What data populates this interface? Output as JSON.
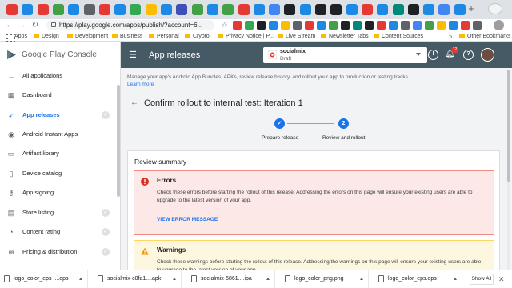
{
  "browser": {
    "url": "https://play.google.com/apps/publish/?account=6...",
    "new_tab_symbol": "+",
    "tab_colors": [
      "#e53935",
      "#1e88e5",
      "#e53935",
      "#43a047",
      "#1e88e5",
      "#5f6368",
      "#e53935",
      "#1e88e5",
      "#34a853",
      "#fbbc04",
      "#1e88e5",
      "#3f51b5",
      "#43a047",
      "#1e88e5",
      "#43a047",
      "#e53935",
      "#1e88e5",
      "#4285f4",
      "#202124",
      "#1e88e5",
      "#202124",
      "#202124",
      "#1e88e5",
      "#e53935",
      "#1e88e5",
      "#00897b",
      "#202124",
      "#1e88e5",
      "#4285f4",
      "#1e88e5"
    ],
    "bookmarks": {
      "apps": "Apps",
      "design": "Design",
      "development": "Development",
      "business": "Business",
      "personal": "Personal",
      "crypto": "Crypto",
      "privacy": "Privacy Notice | P...",
      "livestream": "Live Stream",
      "newsletter": "Newsletter Tabs",
      "content": "Content Sources",
      "other": "Other Bookmarks",
      "more": "»"
    }
  },
  "console": {
    "brand": "Google Play Console",
    "header_title": "App releases",
    "app_name": "socialmix",
    "app_status": "Draft",
    "notification_count": "12",
    "help_symbol": "?",
    "info_symbol": "!",
    "sidebar": {
      "all_apps": "All applications",
      "dashboard": "Dashboard",
      "app_releases": "App releases",
      "instant_apps": "Android Instant Apps",
      "artifact_library": "Artifact library",
      "device_catalog": "Device catalog",
      "app_signing": "App signing",
      "store_listing": "Store listing",
      "content_rating": "Content rating",
      "pricing": "Pricing & distribution"
    }
  },
  "main": {
    "description": "Manage your app's Android App Bundles, APKs, review release history, and rollout your app to production or testing tracks.",
    "learn_more": "Learn more",
    "page_title": "Confirm rollout to internal test: Iteration 1",
    "steps": {
      "step1_mark": "✓",
      "step1_label": "Prepare release",
      "step2_mark": "2",
      "step2_label": "Review and rollout"
    },
    "review_summary": "Review summary",
    "errors": {
      "title": "Errors",
      "body": "Check these errors before starting the rollout of this release. Addressing the errors on this page will ensure your existing users are able to upgrade to the latest version of your app.",
      "link": "VIEW ERROR MESSAGE"
    },
    "warnings": {
      "title": "Warnings",
      "body": "Check these warnings before starting the rollout of this release. Addressing the warnings on this page will ensure your existing users are able to upgrade to the latest version of your app."
    }
  },
  "downloads": {
    "files": [
      "logo_color_eps ....eps",
      "socialmix-c8fa1....apk",
      "socialmix-5861....ipa",
      "logo_color_png.png",
      "logo_color_eps.eps"
    ],
    "show_all": "Show All",
    "close": "✕"
  },
  "colors": {
    "header": "#455a64",
    "accent": "#1a73e8",
    "error_bg": "#fce8e6",
    "warning_bg": "#fef7e0"
  }
}
